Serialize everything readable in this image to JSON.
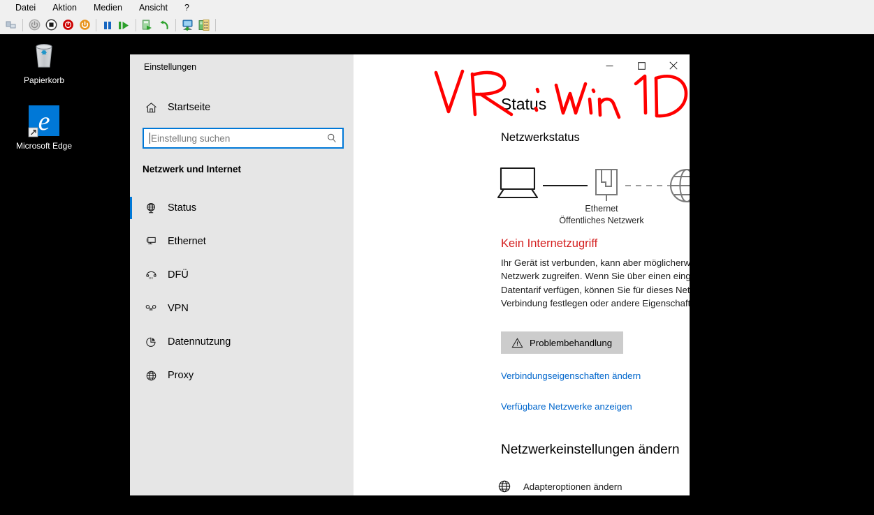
{
  "mmc": {
    "menu": [
      {
        "name": "menu-datei",
        "label": "Datei"
      },
      {
        "name": "menu-aktion",
        "label": "Aktion"
      },
      {
        "name": "menu-medien",
        "label": "Medien"
      },
      {
        "name": "menu-ansicht",
        "label": "Ansicht"
      },
      {
        "name": "menu-help",
        "label": "?"
      }
    ],
    "toolbar": [
      {
        "name": "show-hide-tree-button",
        "icon": "panes-icon",
        "title": "Konsolenstruktur ein-/ausblenden"
      },
      {
        "name": "power-off-button",
        "icon": "power-gray-icon",
        "title": "Ausschalten"
      },
      {
        "name": "stop-button",
        "icon": "stop-icon",
        "title": "Ausschalten"
      },
      {
        "name": "shutdown-button",
        "icon": "power-red-icon",
        "title": "Herunterfahren"
      },
      {
        "name": "reset-button",
        "icon": "power-orange-icon",
        "title": "Zurücksetzen"
      },
      {
        "name": "pause-button",
        "icon": "pause-icon",
        "title": "Anhalten"
      },
      {
        "name": "start-button",
        "icon": "play-icon",
        "title": "Starten"
      },
      {
        "name": "checkpoint-button",
        "icon": "checkpoint-icon",
        "title": "Prüfpunkt"
      },
      {
        "name": "revert-button",
        "icon": "revert-icon",
        "title": "Zurücksetzen"
      },
      {
        "name": "connect-button",
        "icon": "monitor-icon",
        "title": "Verbinden"
      },
      {
        "name": "settings-button",
        "icon": "vm-settings-icon",
        "title": "Einstellungen"
      }
    ]
  },
  "desktop": {
    "background_color": "#000000",
    "icons": [
      {
        "name": "desktop-icon-recycle-bin",
        "label": "Papierkorb",
        "icon": "recycle-bin-icon"
      },
      {
        "name": "desktop-icon-edge",
        "label": "Microsoft Edge",
        "icon": "edge-icon"
      }
    ]
  },
  "settings": {
    "app_title": "Einstellungen",
    "titlebar": {
      "minimize": "—",
      "maximize": "□",
      "close": "✕"
    },
    "sidebar": {
      "home_label": "Startseite",
      "search_placeholder": "Einstellung suchen",
      "search_value": "",
      "section_title": "Netzwerk und Internet",
      "items": [
        {
          "name": "sidebar-item-status",
          "label": "Status",
          "icon": "globe-status-icon",
          "active": true
        },
        {
          "name": "sidebar-item-ethernet",
          "label": "Ethernet",
          "icon": "ethernet-icon",
          "active": false
        },
        {
          "name": "sidebar-item-dfue",
          "label": "DFÜ",
          "icon": "dialup-icon",
          "active": false
        },
        {
          "name": "sidebar-item-vpn",
          "label": "VPN",
          "icon": "vpn-icon",
          "active": false
        },
        {
          "name": "sidebar-item-datennutzung",
          "label": "Datennutzung",
          "icon": "pie-chart-icon",
          "active": false
        },
        {
          "name": "sidebar-item-proxy",
          "label": "Proxy",
          "icon": "globe-icon",
          "active": false
        }
      ]
    },
    "main": {
      "page_title": "Status",
      "section_heading": "Netzwerkstatus",
      "diagram": {
        "device_icon": "laptop-icon",
        "link1_style": "solid",
        "adapter_icon": "ethernet-port-icon",
        "link2_style": "dashed",
        "internet_icon": "globe-icon",
        "adapter_label": "Ethernet",
        "network_label": "Öffentliches Netzwerk"
      },
      "status_headline": "Kein Internetzugriff",
      "status_headline_color": "#d41f1f",
      "status_body": "Ihr Gerät ist verbunden, kann aber möglicherweise nicht auf das Netzwerk zugreifen. Wenn Sie über einen eingeschränkten Datentarif verfügen, können Sie für dieses Netzwerk eine getaktete Verbindung festlegen oder andere Eigenschaften ändern.",
      "troubleshoot_button": "Problembehandlung",
      "links": [
        {
          "name": "link-change-connection-properties",
          "label": "Verbindungseigenschaften ändern"
        },
        {
          "name": "link-show-available-networks",
          "label": "Verfügbare Netzwerke anzeigen"
        }
      ],
      "subsection_heading": "Netzwerkeinstellungen ändern",
      "adapter_option": {
        "name": "link-change-adapter-options",
        "label": "Adapteroptionen ändern",
        "icon": "globe-icon"
      }
    }
  },
  "annotation": {
    "text": "VR : Win 10",
    "color": "#ff0000",
    "type": "handwriting-overlay"
  }
}
